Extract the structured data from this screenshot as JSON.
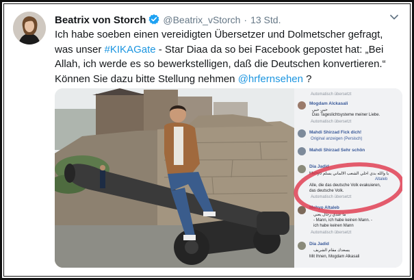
{
  "tweet": {
    "display_name": "Beatrix von Storch",
    "handle": "@Beatrix_vStorch",
    "separator": "·",
    "time": "13 Std.",
    "text_1": "Ich habe soeben einen vereidigten Übersetzer und Dolmetscher gefragt, was unser ",
    "hashtag": "#KIKAGate",
    "text_2": " - Star Diaa da so bei Facebook gepostet hat: „Bei Allah, ich werde es so bewerkstelligen, daß die Deutschen konvertieren.“ Können Sie dazu bitte Stellung nehmen ",
    "mention": "@hrfernsehen",
    "text_3": " ?"
  },
  "media": {
    "comments": {
      "auto_label_1": "Automatisch übersetzt",
      "name_1": "Mogdam Alckasali",
      "arabic_1": "حبي حبي",
      "text_1": "Das Tageslichtsysteme meiner Liebe.",
      "auto_label_2": "Automatisch übersetzt",
      "name_2": "Mahdi Shirzad Fick dich!",
      "original_link": "Original anzeigen (Persisch)",
      "name_3": "Mahdi Shirzad Sehr schön",
      "name_4": "Dia Jadid",
      "arabic_2": "Mehyo يا والله بدي اخلي الشعب الالماني يسلم",
      "tag": "Altaleb",
      "text_4a": "Alle, die das deutsche Volk evakuieren,",
      "text_4b": "das deutsche Volk.",
      "auto_label_3": "Automatisch übersetzt",
      "name_5": "Mehyo Altaleb",
      "arabic_3": "ما عندي رجال يعني",
      "text_5a": "- Mann, ich habe keinen Mann. -",
      "text_5b": "ich habe keinen Mann",
      "auto_label_4": "Automatisch übersetzt",
      "name_6": "Dia Jadid",
      "arabic_4": "يسعدك مقام الشريف",
      "text_6": "Mit Ihnen, Mogdam Alkasali"
    }
  },
  "colors": {
    "text": "#14171a",
    "muted": "#657786",
    "link": "#1b95e0",
    "verified": "#1da1f2",
    "fb_name": "#385898",
    "annotation_circle": "#e0344a"
  }
}
